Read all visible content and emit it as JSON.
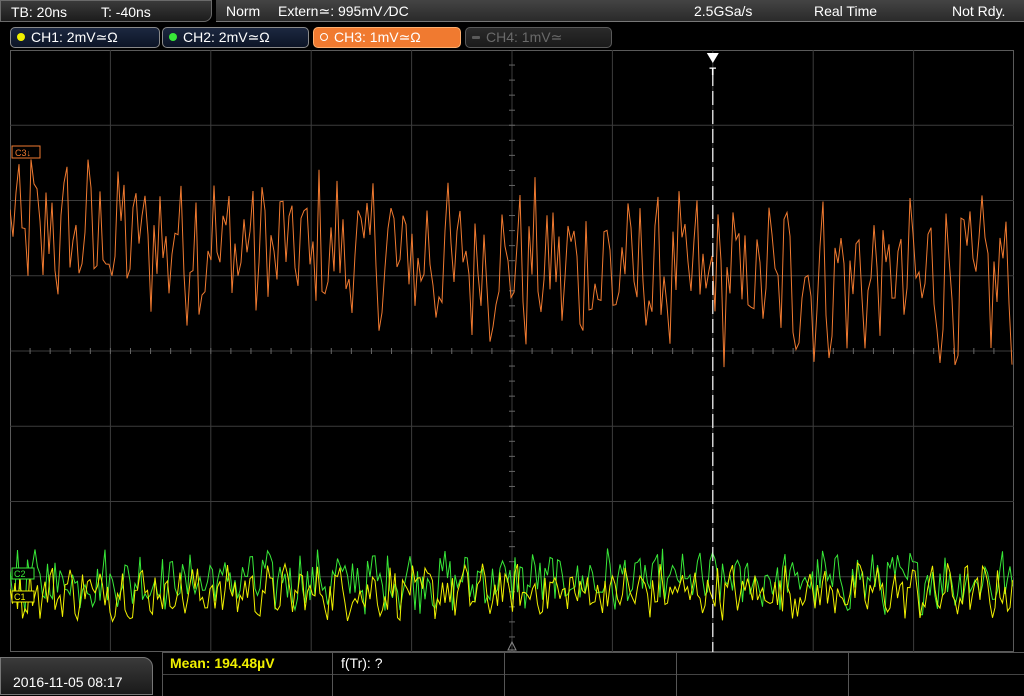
{
  "top": {
    "timebase": "TB: 20ns",
    "trigger_time": "T: -40ns",
    "mode": "Norm",
    "trigger_source": "Extern≃: 995mV ∕DC",
    "sample_rate": "2.5GSa/s",
    "acq_mode": "Real Time",
    "status": "Not Rdy."
  },
  "channels": [
    {
      "label": "CH1: 2mV≃Ω",
      "color": "#f0f000",
      "state": "on"
    },
    {
      "label": "CH2: 2mV≃Ω",
      "color": "#38e838",
      "state": "on"
    },
    {
      "label": "CH3: 1mV≃Ω",
      "color": "#f07a30",
      "state": "selected"
    },
    {
      "label": "CH4: 1mV≃",
      "color": "#5a5a5a",
      "state": "off"
    }
  ],
  "markers": {
    "ch3": "C3↓",
    "ch2": "C2",
    "ch1": "C1",
    "trigger": "T"
  },
  "waveform": {
    "ch3": {
      "start_level": 1.6,
      "end_level": 0.95,
      "noise": 0.9
    },
    "ch2": {
      "level": -3.05,
      "noise": 0.35
    },
    "ch1": {
      "level": -3.2,
      "noise": 0.3
    },
    "trigger_position_div": 7.0
  },
  "bottom": {
    "datetime": "2016-11-05 08:17",
    "mean": "Mean: 194.48µV",
    "ftr": "f(Tr): ?"
  },
  "colors": {
    "ch1": "#f0f000",
    "ch2": "#38e838",
    "ch3": "#f07a30",
    "grid": "#3c3c3c",
    "trigger_line": "#ffffff"
  }
}
